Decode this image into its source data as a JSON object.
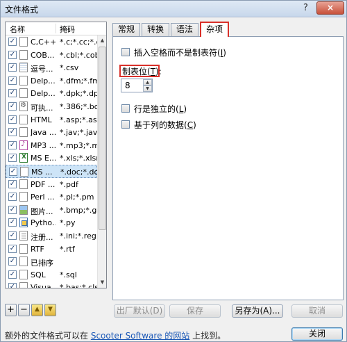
{
  "window": {
    "title": "文件格式",
    "help_glyph": "?",
    "close_glyph": "×"
  },
  "list": {
    "header_name": "名称",
    "header_mask": "掩码",
    "rows": [
      {
        "name": "C,C++...",
        "mask": "*.c;*.cc;*.c...",
        "icon": "document-icon",
        "checked": true
      },
      {
        "name": "COB...",
        "mask": "*.cbl;*.cob...",
        "icon": "document-icon",
        "checked": true
      },
      {
        "name": "逗号...",
        "mask": "*.csv",
        "icon": "table-icon",
        "checked": true
      },
      {
        "name": "Delp...",
        "mask": "*.dfm;*.fm...",
        "icon": "document-icon",
        "checked": true
      },
      {
        "name": "Delp...",
        "mask": "*.dpk;*.dp...",
        "icon": "document-icon",
        "checked": true
      },
      {
        "name": "可执...",
        "mask": "*.386;*.bc...",
        "icon": "gear-icon",
        "checked": true
      },
      {
        "name": "HTML",
        "mask": "*.asp;*.asc",
        "icon": "document-icon",
        "checked": true
      },
      {
        "name": "Java ...",
        "mask": "*.jav;*.java",
        "icon": "document-icon",
        "checked": true
      },
      {
        "name": "MP3 ...",
        "mask": "*.mp3;*.m...",
        "icon": "music-icon",
        "checked": true
      },
      {
        "name": "MS E...",
        "mask": "*.xls;*.xlsm",
        "icon": "excel-icon",
        "checked": true
      },
      {
        "name": "MS ...",
        "mask": "*.doc;*.do...",
        "icon": "word-icon",
        "checked": true,
        "selected": true
      },
      {
        "name": "PDF ...",
        "mask": "*.pdf",
        "icon": "pdf-icon",
        "checked": true
      },
      {
        "name": "Perl ...",
        "mask": "*.pl;*.pm",
        "icon": "document-icon",
        "checked": true
      },
      {
        "name": "图片...",
        "mask": "*.bmp;*.gi...",
        "icon": "picture-icon",
        "checked": true
      },
      {
        "name": "Pytho...",
        "mask": "*.py",
        "icon": "python-icon",
        "checked": true
      },
      {
        "name": "注册...",
        "mask": "*.ini;*.reg",
        "icon": "script-icon",
        "checked": true
      },
      {
        "name": "RTF",
        "mask": "*.rtf",
        "icon": "document-icon",
        "checked": true
      },
      {
        "name": "已排序",
        "mask": "",
        "icon": "document-icon",
        "checked": true
      },
      {
        "name": "SQL",
        "mask": "*.sql",
        "icon": "document-icon",
        "checked": true
      },
      {
        "name": "Visua...",
        "mask": "*.bas;*.cls;...",
        "icon": "document-icon",
        "checked": true
      }
    ]
  },
  "list_buttons": {
    "add": "+",
    "remove": "−",
    "up": "▲",
    "down": "▼"
  },
  "tabs": [
    {
      "label": "常规"
    },
    {
      "label": "转换"
    },
    {
      "label": "语法"
    },
    {
      "label": "杂项",
      "active": true
    }
  ],
  "misc": {
    "insert_spaces": {
      "text": "插入空格而不是制表符(",
      "key": "I",
      "suffix": ")",
      "checked": false
    },
    "tab_stop": {
      "text": "制表位(",
      "key": "T",
      "suffix": "):",
      "value": "8"
    },
    "lines_independent": {
      "text": "行是独立的(",
      "key": "L",
      "suffix": ")",
      "checked": false
    },
    "column_based": {
      "text": "基于列的数据(",
      "key": "C",
      "suffix": ")",
      "checked": false
    }
  },
  "buttons": {
    "factory_default": "出厂默认(D)",
    "save": "保存",
    "save_as": "另存为(A)...",
    "cancel": "取消",
    "close": "关闭"
  },
  "footer": {
    "prefix": "额外的文件格式可以在 ",
    "link": "Scooter Software 的网站",
    "suffix": " 上找到。"
  }
}
